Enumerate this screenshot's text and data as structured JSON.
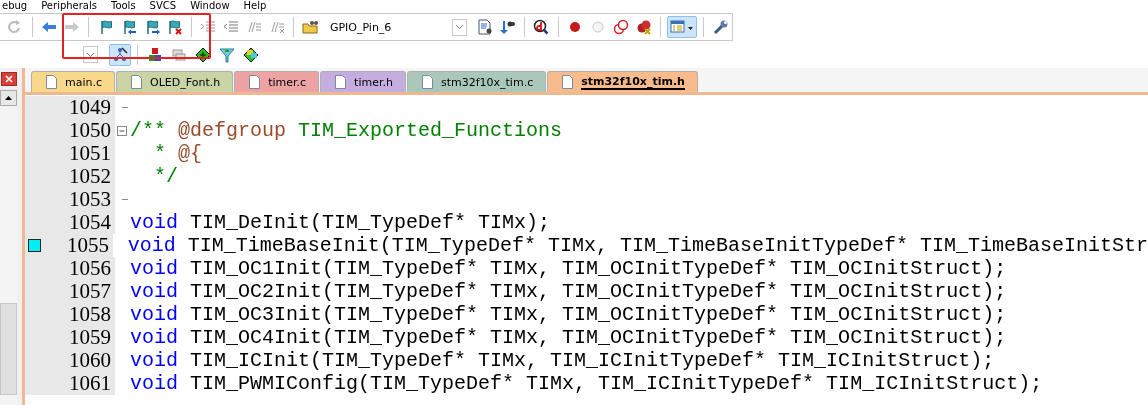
{
  "menu": [
    "ebug",
    "Peripherals",
    "Tools",
    "SVCS",
    "Window",
    "Help"
  ],
  "target_combo": {
    "value": "GPIO_Pin_6"
  },
  "tabs": [
    {
      "label": "main.c",
      "color": "#f8d98c",
      "selected": false
    },
    {
      "label": "OLED_Font.h",
      "color": "#c9d3a3",
      "selected": false
    },
    {
      "label": "timer.c",
      "color": "#eda3a3",
      "selected": false
    },
    {
      "label": "timer.h",
      "color": "#c5ade0",
      "selected": false
    },
    {
      "label": "stm32f10x_tim.c",
      "color": "#a9c8ba",
      "selected": false
    },
    {
      "label": "stm32f10x_tim.h",
      "color": "#f7bb8c",
      "selected": true
    }
  ],
  "editor": {
    "lines": [
      {
        "number": "1049",
        "bookmark": false,
        "collapsible": false,
        "fold_end": true
      },
      {
        "number": "1050",
        "bookmark": false,
        "collapsible": true,
        "fold_end": false,
        "tokens": [
          {
            "kind": "comment",
            "text": "/** "
          },
          {
            "kind": "tag",
            "text": "@defgroup"
          },
          {
            "kind": "comment",
            "text": " TIM_Exported_Functions"
          }
        ]
      },
      {
        "number": "1051",
        "bookmark": false,
        "collapsible": false,
        "fold_end": false,
        "tokens": [
          {
            "kind": "comment",
            "text": "  * "
          },
          {
            "kind": "tag",
            "text": "@{"
          }
        ]
      },
      {
        "number": "1052",
        "bookmark": false,
        "collapsible": false,
        "fold_end": false,
        "tokens": [
          {
            "kind": "comment",
            "text": "  */"
          }
        ]
      },
      {
        "number": "1053",
        "bookmark": false,
        "collapsible": false,
        "fold_end": true
      },
      {
        "number": "1054",
        "bookmark": false,
        "collapsible": false,
        "fold_end": false,
        "tokens": [
          {
            "kind": "keyword",
            "text": "void"
          },
          {
            "kind": "plain",
            "text": " TIM_DeInit(TIM_TypeDef* TIMx);"
          }
        ]
      },
      {
        "number": "1055",
        "bookmark": true,
        "collapsible": false,
        "fold_end": false,
        "tokens": [
          {
            "kind": "keyword",
            "text": "void"
          },
          {
            "kind": "plain",
            "text": " TIM_TimeBaseInit(TIM_TypeDef* TIMx, TIM_TimeBaseInitTypeDef* TIM_TimeBaseInitStr"
          }
        ]
      },
      {
        "number": "1056",
        "bookmark": false,
        "collapsible": false,
        "fold_end": false,
        "tokens": [
          {
            "kind": "keyword",
            "text": "void"
          },
          {
            "kind": "plain",
            "text": " TIM_OC1Init(TIM_TypeDef* TIMx, TIM_OCInitTypeDef* TIM_OCInitStruct);"
          }
        ]
      },
      {
        "number": "1057",
        "bookmark": false,
        "collapsible": false,
        "fold_end": false,
        "tokens": [
          {
            "kind": "keyword",
            "text": "void"
          },
          {
            "kind": "plain",
            "text": " TIM_OC2Init(TIM_TypeDef* TIMx, TIM_OCInitTypeDef* TIM_OCInitStruct);"
          }
        ]
      },
      {
        "number": "1058",
        "bookmark": false,
        "collapsible": false,
        "fold_end": false,
        "tokens": [
          {
            "kind": "keyword",
            "text": "void"
          },
          {
            "kind": "plain",
            "text": " TIM_OC3Init(TIM_TypeDef* TIMx, TIM_OCInitTypeDef* TIM_OCInitStruct);"
          }
        ]
      },
      {
        "number": "1059",
        "bookmark": false,
        "collapsible": false,
        "fold_end": false,
        "tokens": [
          {
            "kind": "keyword",
            "text": "void"
          },
          {
            "kind": "plain",
            "text": " TIM_OC4Init(TIM_TypeDef* TIMx, TIM_OCInitTypeDef* TIM_OCInitStruct);"
          }
        ]
      },
      {
        "number": "1060",
        "bookmark": false,
        "collapsible": false,
        "fold_end": false,
        "tokens": [
          {
            "kind": "keyword",
            "text": "void"
          },
          {
            "kind": "plain",
            "text": " TIM_ICInit(TIM_TypeDef* TIMx, TIM_ICInitTypeDef* TIM_ICInitStruct);"
          }
        ]
      },
      {
        "number": "1061",
        "bookmark": false,
        "collapsible": false,
        "fold_end": false,
        "tokens": [
          {
            "kind": "keyword",
            "text": "void"
          },
          {
            "kind": "plain",
            "text": " TIM_PWMIConfig(TIM_TypeDef* TIMx, TIM_ICInitTypeDef* TIM_ICInitStruct);"
          }
        ]
      }
    ]
  }
}
